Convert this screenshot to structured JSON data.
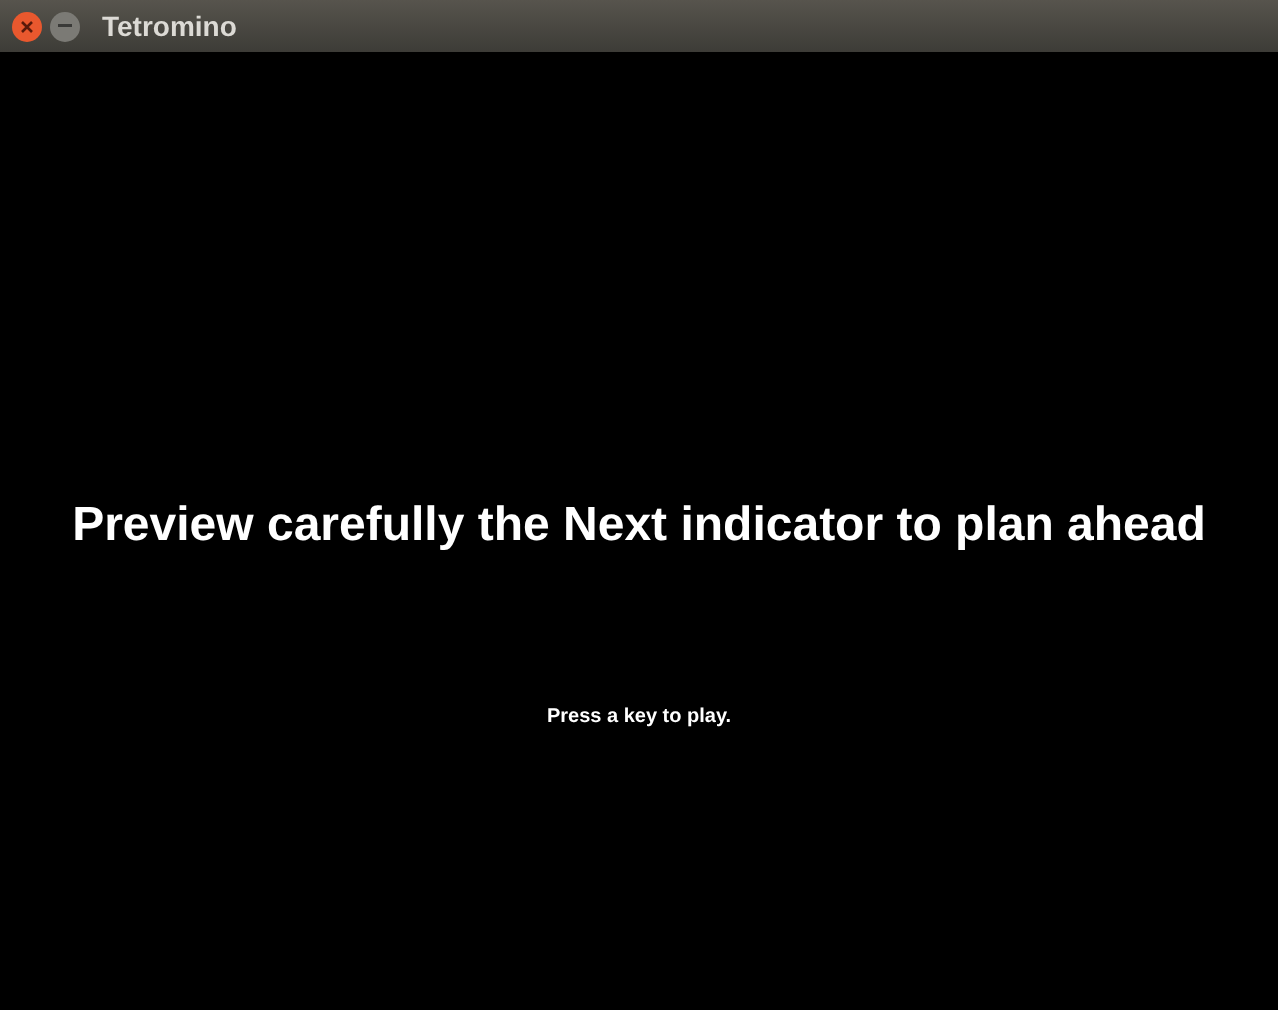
{
  "window": {
    "title": "Tetromino"
  },
  "screen": {
    "tip": "Preview carefully the Next indicator to plan ahead",
    "prompt": "Press a key to play."
  }
}
